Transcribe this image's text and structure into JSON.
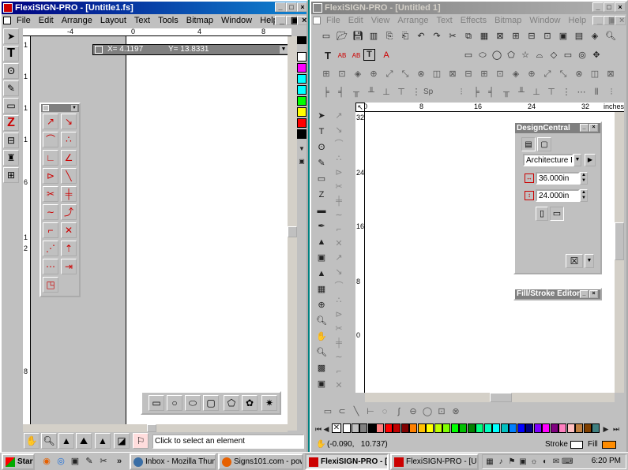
{
  "left_window": {
    "title": "FlexiSIGN-PRO - [Untitle1.fs]",
    "menu": [
      "File",
      "Edit",
      "Arrange",
      "Layout",
      "Text",
      "Tools",
      "Bitmap",
      "Window",
      "Help"
    ],
    "ruler_top_labels": [
      "-4",
      "0",
      "4",
      "8"
    ],
    "ruler_left_labels": [
      "1",
      "1",
      "1",
      "1",
      "6",
      "1",
      "2",
      "8"
    ],
    "coord_x": "X= 4.1197",
    "coord_y": "Y= 13.8331",
    "status_text": "Click to select an element"
  },
  "right_window": {
    "title": "FlexiSIGN-PRO - [Untitled 1]",
    "menu": [
      "File",
      "Edit",
      "View",
      "Arrange",
      "Text",
      "Effects",
      "Bitmap",
      "Window",
      "Help"
    ],
    "ruler_top_labels": [
      "0",
      "8",
      "16",
      "24",
      "32"
    ],
    "ruler_units": "inches",
    "ruler_left_labels": [
      "32",
      "24",
      "16",
      "8",
      "0"
    ],
    "text_toolbar": [
      "T",
      "AB",
      "AB",
      "T",
      "A"
    ],
    "sp_label": "Sp",
    "status_coords": "(-0.090,   10.737)",
    "stroke_label": "Stroke",
    "fill_label": "Fill"
  },
  "design_central": {
    "title": "DesignCentral",
    "preset": "Architecture D",
    "width": "36.000in",
    "height": "24.000in"
  },
  "fill_stroke": {
    "title": "Fill/Stroke Editor"
  },
  "taskbar": {
    "start": "Start",
    "items": [
      "Inbox - Mozilla Thund...",
      "Signs101.com - power...",
      "FlexiSIGN-PRO - [...",
      "FlexiSIGN-PRO - [Unti..."
    ],
    "clock": "6:20 PM"
  },
  "colors": {
    "vertical_palette": [
      "#ffffff",
      "#ff00ff",
      "#00ffff",
      "#00ffff",
      "#00ff00",
      "#ffff00",
      "#ff0000",
      "#000000"
    ],
    "bottom_palette": [
      "#ffffff",
      "#c0c0c0",
      "#808080",
      "#000000",
      "#ff8080",
      "#ff0000",
      "#c00000",
      "#800000",
      "#ff8000",
      "#ffc000",
      "#ffff00",
      "#c0ff00",
      "#80ff00",
      "#00ff00",
      "#00c000",
      "#008000",
      "#00ff80",
      "#00ffc0",
      "#00ffff",
      "#00c0c0",
      "#0080ff",
      "#0000ff",
      "#000080",
      "#8000ff",
      "#ff00ff",
      "#800080",
      "#ff80c0",
      "#ffc0c0",
      "#c08040",
      "#804000",
      "#408080"
    ]
  }
}
